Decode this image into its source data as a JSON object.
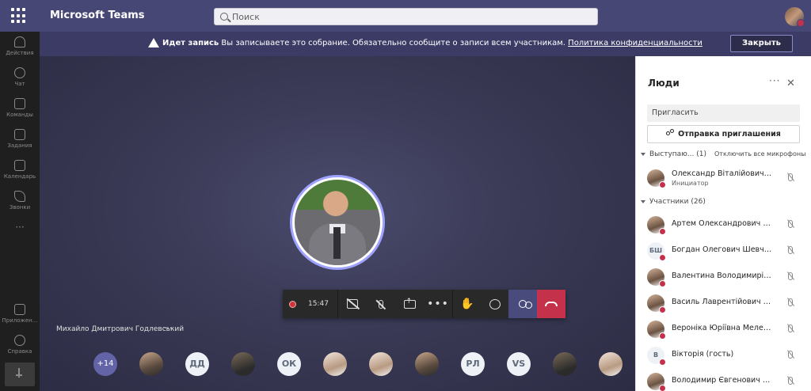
{
  "app": {
    "title": "Microsoft Teams"
  },
  "search": {
    "placeholder": "Поиск"
  },
  "rail": {
    "items": [
      {
        "label": "Действия",
        "icon": "bell-icon"
      },
      {
        "label": "Чат",
        "icon": "chat-icon"
      },
      {
        "label": "Команды",
        "icon": "teams-icon"
      },
      {
        "label": "Задания",
        "icon": "assignments-icon"
      },
      {
        "label": "Календарь",
        "icon": "calendar-icon"
      },
      {
        "label": "Звонки",
        "icon": "phone-icon"
      }
    ],
    "more": "···",
    "apps_label": "Приложен...",
    "help_label": "Справка"
  },
  "banner": {
    "bold": "Идет запись",
    "text": "Вы записываете это собрание. Обязательно сообщите о записи всем участникам.",
    "link": "Политика конфиденциальности",
    "close_label": "Закрыть"
  },
  "stage": {
    "speaker_name": "Михайло Дмитрович Годлевський",
    "speaker_more": "···"
  },
  "controls": {
    "timer": "15:47",
    "more": "•••"
  },
  "strip": [
    {
      "kind": "more",
      "text": "+14"
    },
    {
      "kind": "photo",
      "text": ""
    },
    {
      "kind": "initials",
      "text": "ДД"
    },
    {
      "kind": "photo",
      "text": ""
    },
    {
      "kind": "initials",
      "text": "ОК"
    },
    {
      "kind": "photo",
      "text": ""
    },
    {
      "kind": "photo",
      "text": ""
    },
    {
      "kind": "photo",
      "text": ""
    },
    {
      "kind": "initials",
      "text": "РЛ"
    },
    {
      "kind": "initials",
      "text": "VS"
    },
    {
      "kind": "photo",
      "text": ""
    },
    {
      "kind": "photo",
      "text": ""
    }
  ],
  "panel": {
    "title": "Люди",
    "more": "···",
    "close": "✕",
    "invite_placeholder": "Пригласить",
    "invite_button": "Отправка приглашения",
    "presenters_label": "Выступаю... (1)",
    "mute_all": "Отключить все микрофоны",
    "presenters": [
      {
        "name": "Олександр Віталійович Шм...",
        "role": "Инициатор",
        "avatar": ""
      }
    ],
    "participants_label": "Участники (26)",
    "participants": [
      {
        "name": "Артем Олександрович Бон...",
        "avatar": ""
      },
      {
        "name": "Богдан Олегович Шевченко",
        "avatar": "БШ"
      },
      {
        "name": "Валентина Володимирівна Моск...",
        "avatar": ""
      },
      {
        "name": "Василь Лаврентійович Лис...",
        "avatar": ""
      },
      {
        "name": "Вероніка Юріївна Мелехова",
        "avatar": ""
      },
      {
        "name": "Вікторія (гость)",
        "avatar": "В"
      },
      {
        "name": "Володимир Євгенович Сок...",
        "avatar": ""
      }
    ]
  },
  "colors": {
    "brand": "#464775",
    "banner": "#3b3b66",
    "accent": "#6264a7",
    "hangup": "#c4314b",
    "stage": "#3a3a56"
  }
}
